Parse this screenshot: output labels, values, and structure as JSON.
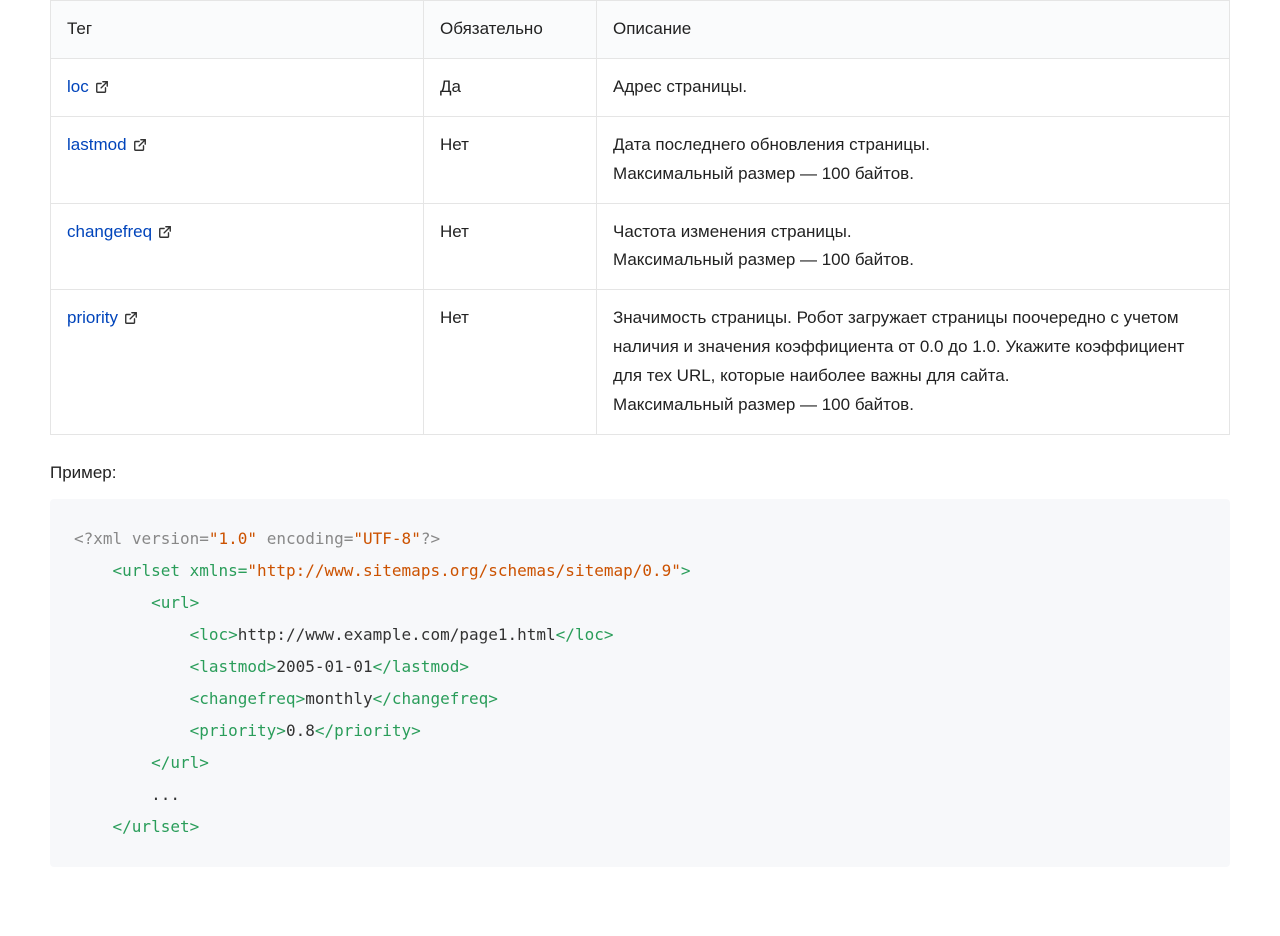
{
  "table": {
    "headers": [
      "Тег",
      "Обязательно",
      "Описание"
    ],
    "rows": [
      {
        "tag": "loc",
        "required": "Да",
        "desc": [
          "Адрес страницы."
        ]
      },
      {
        "tag": "lastmod",
        "required": "Нет",
        "desc": [
          "Дата последнего обновления страницы.",
          "Максимальный размер — 100 байтов."
        ]
      },
      {
        "tag": "changefreq",
        "required": "Нет",
        "desc": [
          "Частота изменения страницы.",
          "Максимальный размер — 100 байтов."
        ]
      },
      {
        "tag": "priority",
        "required": "Нет",
        "desc": [
          "Значимость страницы. Робот загружает страницы поочередно с учетом наличия и значения коэффициента от 0.0 до 1.0. Укажите коэффициент для тех URL, которые наиболее важны для сайта.",
          "Максимальный размер — 100 байтов."
        ]
      }
    ]
  },
  "example_label": "Пример:",
  "code": {
    "xml_version": "1.0",
    "xml_encoding": "UTF-8",
    "xmlns": "http://www.sitemaps.org/schemas/sitemap/0.9",
    "loc": "http://www.example.com/page1.html",
    "lastmod": "2005-01-01",
    "changefreq": "monthly",
    "priority": "0.8",
    "ellipsis": "..."
  }
}
